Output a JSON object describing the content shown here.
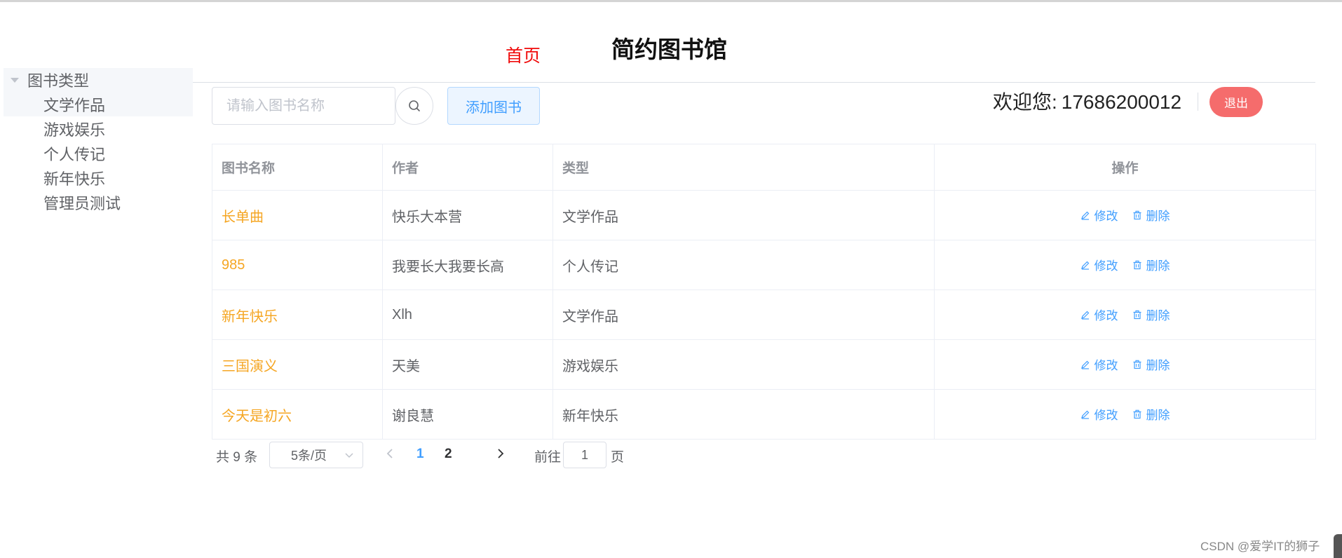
{
  "header": {
    "home_link": "首页",
    "title": "简约图书馆"
  },
  "sidebar": {
    "root_label": "图书类型",
    "items": [
      {
        "label": "文学作品"
      },
      {
        "label": "游戏娱乐"
      },
      {
        "label": "个人传记"
      },
      {
        "label": "新年快乐"
      },
      {
        "label": "管理员测试"
      }
    ]
  },
  "toolbar": {
    "search_placeholder": "请输入图书名称",
    "search_value": "",
    "add_label": "添加图书",
    "welcome_prefix": "欢迎您:",
    "username": "17686200012",
    "logout_label": "退出"
  },
  "table": {
    "columns": [
      "图书名称",
      "作者",
      "类型",
      "操作"
    ],
    "edit_label": "修改",
    "delete_label": "删除",
    "rows": [
      {
        "name": "长单曲",
        "author": "快乐大本营",
        "type": "文学作品"
      },
      {
        "name": "985",
        "author": "我要长大我要长高",
        "type": "个人传记"
      },
      {
        "name": "新年快乐",
        "author": "Xlh",
        "type": "文学作品"
      },
      {
        "name": "三国演义",
        "author": "天美",
        "type": "游戏娱乐"
      },
      {
        "name": "今天是初六",
        "author": "谢良慧",
        "type": "新年快乐"
      }
    ]
  },
  "pagination": {
    "total_text": "共 9 条",
    "page_size": "5条/页",
    "pages": [
      "1",
      "2"
    ],
    "current_page": "1",
    "goto_label": "前往",
    "goto_value": "1",
    "page_unit": "页"
  },
  "watermark": "CSDN @爱学IT的狮子",
  "colors": {
    "accent": "#409eff",
    "danger": "#f56c6c",
    "book_name": "#f5a623",
    "home_link": "#f00a0a"
  }
}
